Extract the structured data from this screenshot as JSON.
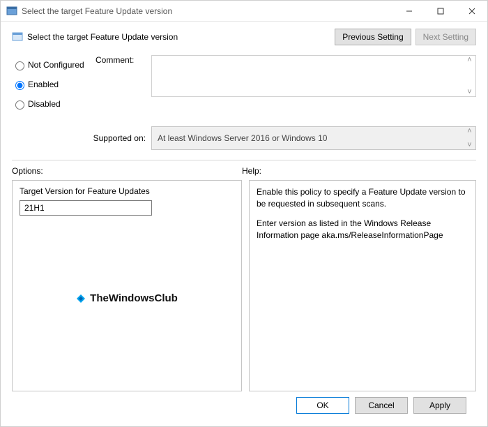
{
  "window": {
    "title": "Select the target Feature Update version"
  },
  "header": {
    "heading": "Select the target Feature Update version",
    "prev_btn": "Previous Setting",
    "next_btn": "Next Setting"
  },
  "state": {
    "not_configured": "Not Configured",
    "enabled": "Enabled",
    "disabled": "Disabled",
    "selected": "enabled"
  },
  "comment": {
    "label": "Comment:",
    "value": ""
  },
  "supported": {
    "label": "Supported on:",
    "value": "At least Windows Server 2016 or Windows 10"
  },
  "options": {
    "section_label": "Options:",
    "field_label": "Target Version for Feature Updates",
    "value": "21H1"
  },
  "help": {
    "section_label": "Help:",
    "text1": "Enable this policy to specify a Feature Update version to be requested in subsequent scans.",
    "text2": "Enter version as listed in the Windows Release Information page aka.ms/ReleaseInformationPage"
  },
  "watermark": "TheWindowsClub",
  "footer": {
    "ok": "OK",
    "cancel": "Cancel",
    "apply": "Apply"
  }
}
